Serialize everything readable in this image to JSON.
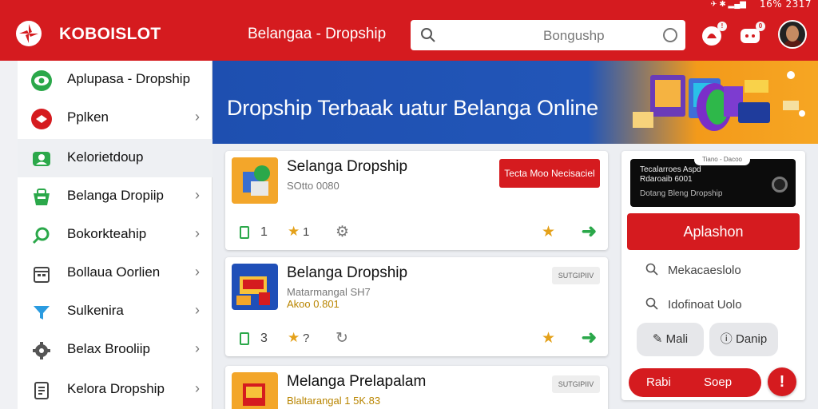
{
  "status": {
    "time": "2317",
    "battery": "16%"
  },
  "header": {
    "brand": "KOBOISLOT",
    "title": "Belangaa - Dropship",
    "search_placeholder": "Bongushp"
  },
  "sidebar": {
    "items": [
      {
        "label": "Aplupasa - Dropship",
        "icon": "eye-icon"
      },
      {
        "label": "Pplken",
        "icon": "brand-icon"
      },
      {
        "label": "Kelorietdoup",
        "icon": "user-icon"
      },
      {
        "label": "Belanga Dropiip",
        "icon": "basket-icon"
      },
      {
        "label": "Bokorkteahip",
        "icon": "search-icon"
      },
      {
        "label": "Bollaua Oorlien",
        "icon": "calendar-icon"
      },
      {
        "label": "Sulkenira",
        "icon": "filter-icon"
      },
      {
        "label": "Belax Brooliip",
        "icon": "gear-icon"
      },
      {
        "label": "Kelora Dropship",
        "icon": "document-icon"
      }
    ]
  },
  "banner": {
    "title": "Dropship Terbaak uatur Belanga Online"
  },
  "cards": [
    {
      "title": "Selanga Dropship",
      "sub1": "SOtto 0080",
      "sub2": "",
      "badge": "Tecta Moo Necisaciel",
      "f_num": "1",
      "star_num": "1"
    },
    {
      "title": "Belanga Dropship",
      "sub1": "Matarmangal SH7",
      "sub2": "Akoo 0.801",
      "badge": "SUTGIPIIV",
      "f_num": "3",
      "star_num": "?"
    },
    {
      "title": "Melanga Prelapalam",
      "sub1": "Blaltarangal 1 5K.83",
      "sub2": "",
      "badge": "SUTGIPIIV",
      "f_num": "",
      "star_num": ""
    }
  ],
  "rpanel": {
    "pill": "Tiano - Dacoo",
    "line1": "Tecalarroes Aspd",
    "line2": "Rdaroaib 6001",
    "line3": "Dotang Bleng Dropship",
    "button": "Aplashon",
    "row1": "Mekacaeslolo",
    "row2": "Idofinoat Uolo",
    "chip1": "Mali",
    "chip2": "Danip",
    "redbar_a": "Rabi",
    "redbar_b": "Soep",
    "alert": "!"
  },
  "colors": {
    "brand_red": "#d51b1f",
    "banner_blue": "#2256b8",
    "banner_orange": "#f39a1a",
    "accent_green": "#2ba84a"
  }
}
